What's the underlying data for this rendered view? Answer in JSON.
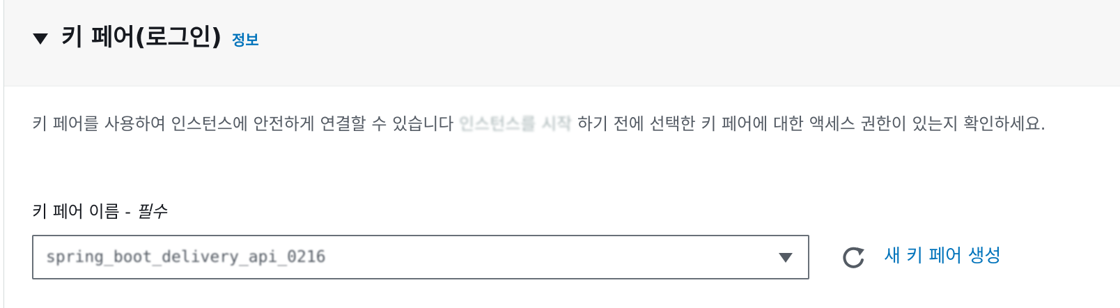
{
  "section": {
    "title": "키 페어(로그인)",
    "info_link": "정보",
    "description_before": "키 페어를 사용하여 인스턴스에 안전하게 연결할 수 있습니다",
    "description_redacted": "인스턴스를 시작",
    "description_after": "하기 전에 선택한 키 페어에 대한 액세스 권한이 있는지 확인하세요."
  },
  "key_pair_field": {
    "label": "키 페어 이름 - ",
    "required_label": "필수",
    "selected_value": "spring_boot_delivery_api_0216",
    "create_link": "새 키 페어 생성"
  },
  "icons": {
    "toggle": "caret-down-icon",
    "select_caret": "caret-down-icon",
    "refresh": "refresh-icon"
  },
  "colors": {
    "link": "#0073bb",
    "text": "#16191f",
    "secondary_text": "#545b64",
    "header_background": "#f7f7f7",
    "border": "#687078"
  }
}
